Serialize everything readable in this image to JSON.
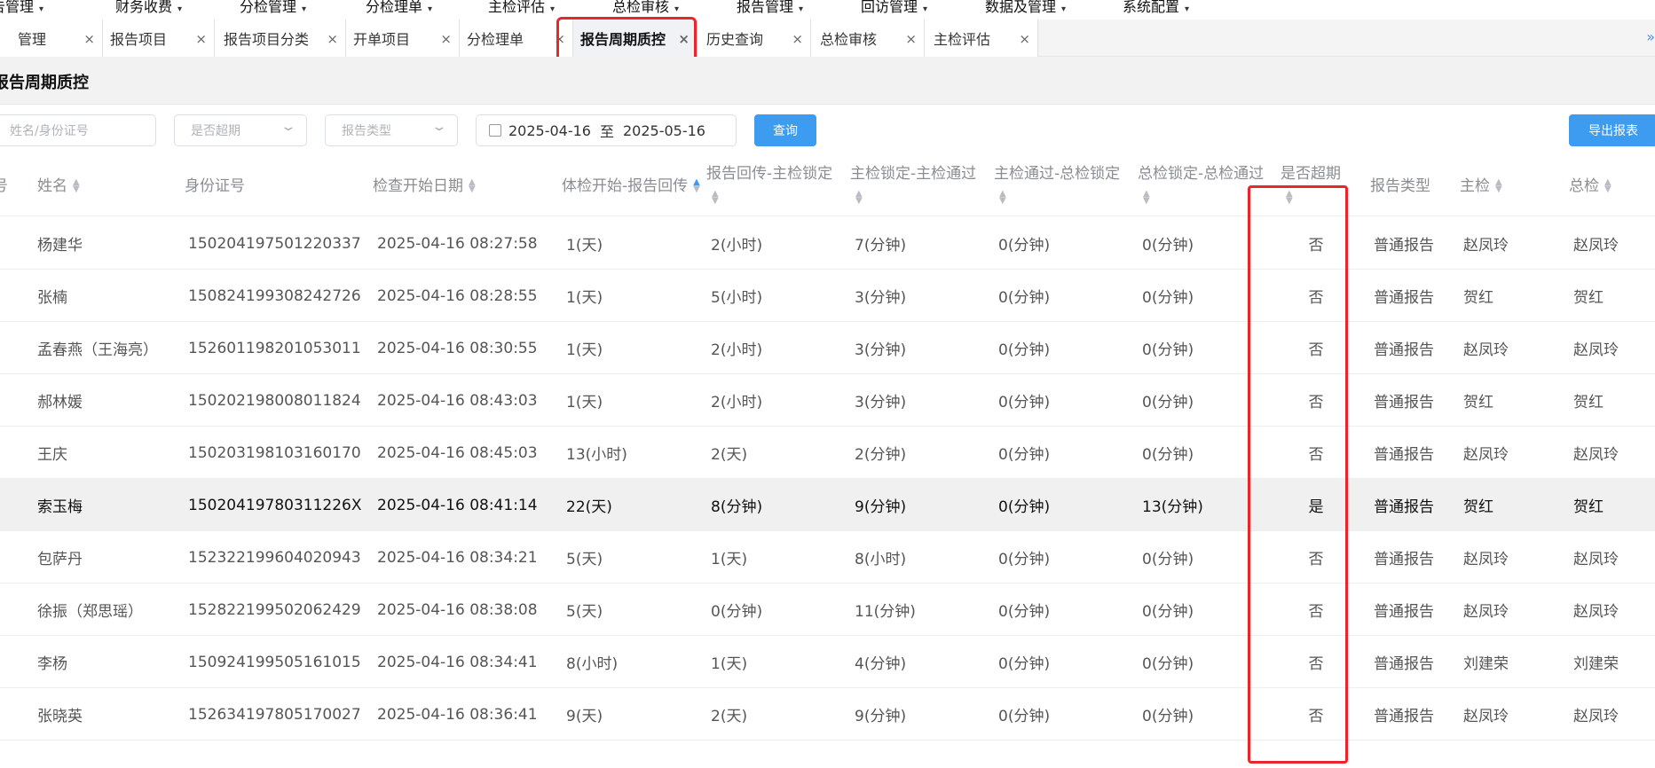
{
  "top_menu": [
    "告管理",
    "财务收费",
    "分检管理",
    "分检理单",
    "主检评估",
    "总检审核",
    "报告管理",
    "回访管理",
    "数据及管理",
    "系统配置"
  ],
  "tabs": [
    {
      "label": "管理"
    },
    {
      "label": "报告项目"
    },
    {
      "label": "报告项目分类"
    },
    {
      "label": "开单项目"
    },
    {
      "label": "分检理单"
    },
    {
      "label": "报告周期质控",
      "active": true
    },
    {
      "label": "历史查询"
    },
    {
      "label": "总检审核"
    },
    {
      "label": "主检评估"
    }
  ],
  "tab_close": "×",
  "tabs_more": "»",
  "page_title": "报告周期质控",
  "filters": {
    "name_id_placeholder": "姓名/身份证号",
    "overdue_placeholder": "是否超期",
    "report_type_placeholder": "报告类型",
    "date_start": "2025-04-16",
    "date_sep": "至",
    "date_end": "2025-05-16"
  },
  "buttons": {
    "query": "查询",
    "export": "导出报表"
  },
  "columns": [
    {
      "label": "号"
    },
    {
      "label": "姓名"
    },
    {
      "label": "身份证号"
    },
    {
      "label": "检查开始日期"
    },
    {
      "label": "体检开始-报告回传"
    },
    {
      "label": "报告回传-主检锁定"
    },
    {
      "label": "主检锁定-主检通过"
    },
    {
      "label": "主检通过-总检锁定"
    },
    {
      "label": "总检锁定-总检通过"
    },
    {
      "label": "是否超期"
    },
    {
      "label": "报告类型"
    },
    {
      "label": "主检"
    },
    {
      "label": "总检"
    }
  ],
  "rows": [
    {
      "name": "杨建华",
      "id": "150204197501220337",
      "start": "2025-04-16 08:27:58",
      "c1": "1(天)",
      "c2": "2(小时)",
      "c3": "7(分钟)",
      "c4": "0(分钟)",
      "c5": "0(分钟)",
      "overdue": "否",
      "type": "普通报告",
      "main": "赵凤玲",
      "total": "赵凤玲"
    },
    {
      "name": "张楠",
      "id": "150824199308242726",
      "start": "2025-04-16 08:28:55",
      "c1": "1(天)",
      "c2": "5(小时)",
      "c3": "3(分钟)",
      "c4": "0(分钟)",
      "c5": "0(分钟)",
      "overdue": "否",
      "type": "普通报告",
      "main": "贺红",
      "total": "贺红"
    },
    {
      "name": "孟春燕（王海亮）",
      "id": "152601198201053011",
      "start": "2025-04-16 08:30:55",
      "c1": "1(天)",
      "c2": "2(小时)",
      "c3": "3(分钟)",
      "c4": "0(分钟)",
      "c5": "0(分钟)",
      "overdue": "否",
      "type": "普通报告",
      "main": "赵凤玲",
      "total": "赵凤玲"
    },
    {
      "name": "郝林媛",
      "id": "150202198008011824",
      "start": "2025-04-16 08:43:03",
      "c1": "1(天)",
      "c2": "2(小时)",
      "c3": "3(分钟)",
      "c4": "0(分钟)",
      "c5": "0(分钟)",
      "overdue": "否",
      "type": "普通报告",
      "main": "贺红",
      "total": "贺红"
    },
    {
      "name": "王庆",
      "id": "150203198103160170",
      "start": "2025-04-16 08:45:03",
      "c1": "13(小时)",
      "c2": "2(天)",
      "c3": "2(分钟)",
      "c4": "0(分钟)",
      "c5": "0(分钟)",
      "overdue": "否",
      "type": "普通报告",
      "main": "赵凤玲",
      "total": "赵凤玲"
    },
    {
      "name": "索玉梅",
      "id": "15020419780311226X",
      "start": "2025-04-16 08:41:14",
      "c1": "22(天)",
      "c2": "8(分钟)",
      "c3": "9(分钟)",
      "c4": "0(分钟)",
      "c5": "13(分钟)",
      "overdue": "是",
      "type": "普通报告",
      "main": "贺红",
      "total": "贺红",
      "highlight": true
    },
    {
      "name": "包萨丹",
      "id": "152322199604020943",
      "start": "2025-04-16 08:34:21",
      "c1": "5(天)",
      "c2": "1(天)",
      "c3": "8(小时)",
      "c4": "0(分钟)",
      "c5": "0(分钟)",
      "overdue": "否",
      "type": "普通报告",
      "main": "赵凤玲",
      "total": "赵凤玲"
    },
    {
      "name": "徐振（郑思瑶）",
      "id": "152822199502062429",
      "start": "2025-04-16 08:38:08",
      "c1": "5(天)",
      "c2": "0(分钟)",
      "c3": "11(分钟)",
      "c4": "0(分钟)",
      "c5": "0(分钟)",
      "overdue": "否",
      "type": "普通报告",
      "main": "赵凤玲",
      "total": "赵凤玲"
    },
    {
      "name": "李杨",
      "id": "150924199505161015",
      "start": "2025-04-16 08:34:41",
      "c1": "8(小时)",
      "c2": "1(天)",
      "c3": "4(分钟)",
      "c4": "0(分钟)",
      "c5": "0(分钟)",
      "overdue": "否",
      "type": "普通报告",
      "main": "刘建荣",
      "total": "刘建荣"
    },
    {
      "name": "张晓英",
      "id": "152634197805170027",
      "start": "2025-04-16 08:36:41",
      "c1": "9(天)",
      "c2": "2(天)",
      "c3": "9(分钟)",
      "c4": "0(分钟)",
      "c5": "0(分钟)",
      "overdue": "否",
      "type": "普通报告",
      "main": "赵凤玲",
      "total": "赵凤玲"
    }
  ],
  "colors": {
    "accent": "#3d9bf0",
    "highlight_box": "#e8262b"
  }
}
